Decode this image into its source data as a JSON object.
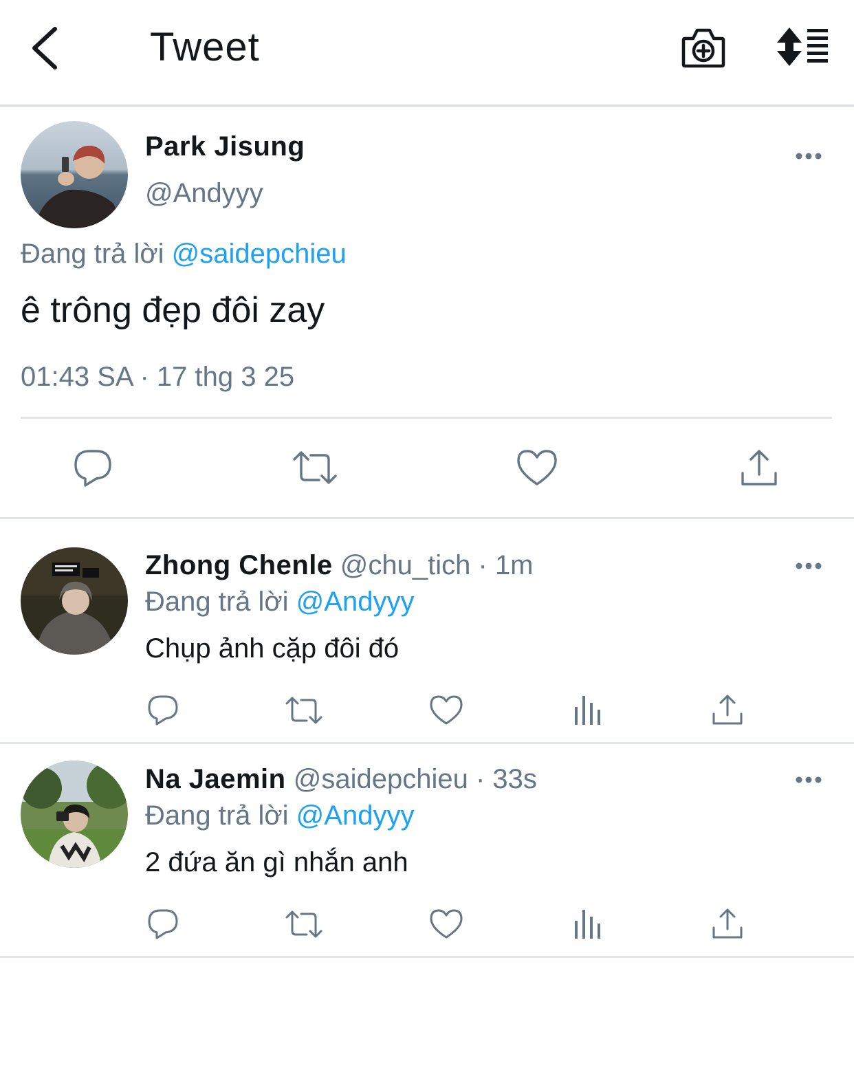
{
  "header": {
    "title": "Tweet",
    "back_icon": "chevron-left-icon",
    "camera_icon": "camera-plus-icon",
    "sort_icon": "sort-list-icon"
  },
  "colors": {
    "link": "#1da1f2",
    "muted": "#657786",
    "text": "#14171a",
    "divider": "#e1e5e8"
  },
  "main_tweet": {
    "name": "Park Jisung",
    "handle": "@Andyyy",
    "reply_prefix": "Đang trả lời",
    "reply_to": "@saidepchieu",
    "text": "ê trông đẹp đôi zay",
    "timestamp": "01:43 SA · 17 thg 3 25",
    "actions": [
      "reply-icon",
      "retweet-icon",
      "like-icon",
      "share-icon"
    ]
  },
  "replies": [
    {
      "name": "Zhong Chenle",
      "handle": "@chu_tich",
      "time": "1m",
      "reply_prefix": "Đang trả lời",
      "reply_to": "@Andyyy",
      "text": "Chụp ảnh cặp đôi đó",
      "actions": [
        "reply-icon",
        "retweet-icon",
        "like-icon",
        "analytics-icon",
        "share-icon"
      ]
    },
    {
      "name": "Na Jaemin",
      "handle": "@saidepchieu",
      "time": "33s",
      "reply_prefix": "Đang trả lời",
      "reply_to": "@Andyyy",
      "text": "2 đứa ăn gì nhắn anh",
      "actions": [
        "reply-icon",
        "retweet-icon",
        "like-icon",
        "analytics-icon",
        "share-icon"
      ]
    }
  ]
}
